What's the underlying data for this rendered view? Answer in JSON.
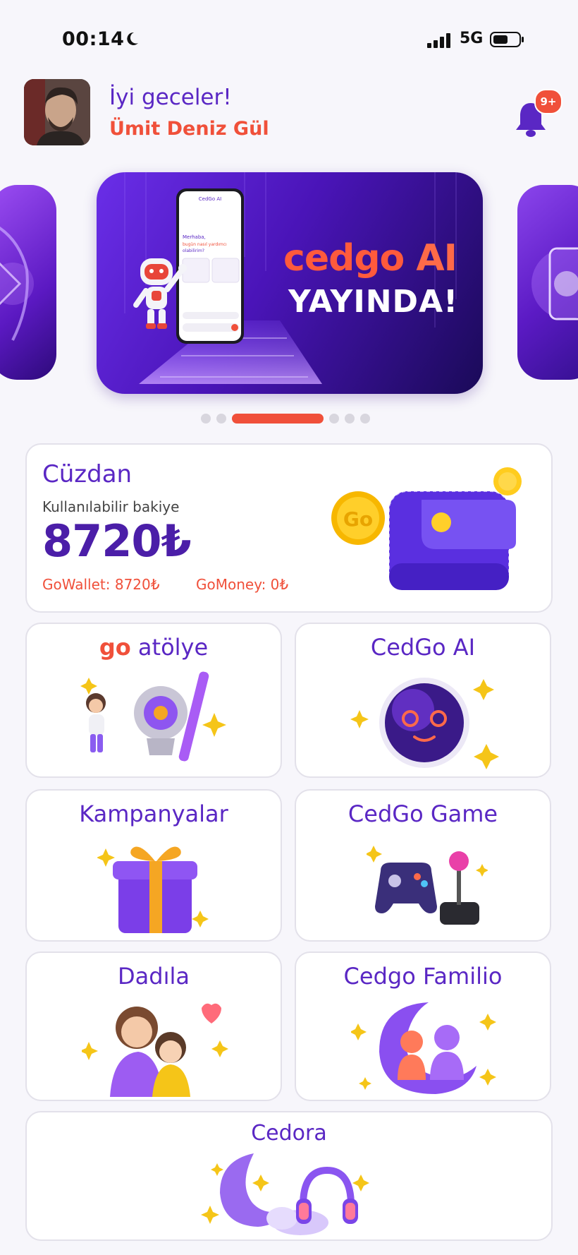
{
  "status_bar": {
    "time": "00:14",
    "network": "5G"
  },
  "header": {
    "greeting": "İyi geceler!",
    "username": "Ümit Deniz Gül",
    "notification_badge": "9+"
  },
  "banner": {
    "brand": "cedgo",
    "brand_ai": "AI",
    "subtitle": "YAYINDA!",
    "active_slide_index": 2,
    "slide_count": 6
  },
  "wallet": {
    "title": "Cüzdan",
    "balance_label": "Kullanılabilir bakiye",
    "balance": "8720₺",
    "gowallet": "GoWallet: 8720₺",
    "gomoney": "GoMoney: 0₺"
  },
  "tiles": [
    {
      "title": "atölye",
      "logo": "go",
      "icon": "atolye-illustration"
    },
    {
      "title": "CedGo AI",
      "icon": "ai-orb-icon"
    },
    {
      "title": "Kampanyalar",
      "icon": "gift-icon"
    },
    {
      "title": "CedGo Game",
      "icon": "gamepad-icon"
    },
    {
      "title": "Dadıla",
      "icon": "mother-child-icon"
    },
    {
      "title": "Cedgo Familio",
      "icon": "family-moon-icon"
    },
    {
      "title": "Cedora",
      "icon": "moon-headphones-icon"
    }
  ],
  "colors": {
    "accent": "#5a27c4",
    "brand_orange": "#f0503a",
    "background": "#f7f6fb"
  }
}
